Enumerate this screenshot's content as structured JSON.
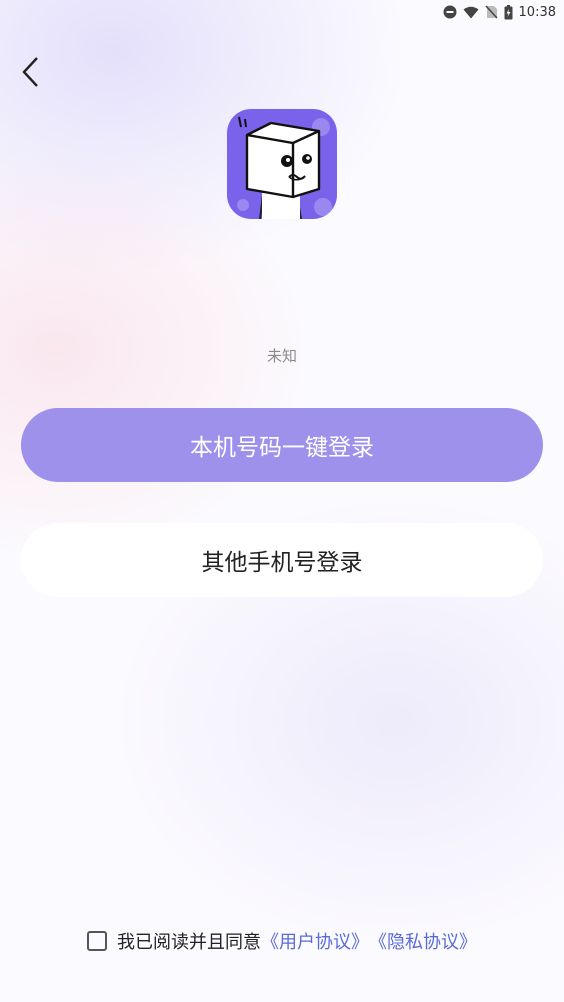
{
  "status_bar": {
    "time": "10:38",
    "icons": [
      "do-not-disturb-icon",
      "wifi-icon",
      "no-sim-icon",
      "battery-icon"
    ]
  },
  "header": {
    "back_icon": "chevron-left-icon"
  },
  "app": {
    "logo_icon": "cube-character-logo"
  },
  "login": {
    "phone_number": "未知",
    "one_click_label": "本机号码一键登录",
    "other_phone_label": "其他手机号登录"
  },
  "agreement": {
    "checked": false,
    "text": "我已阅读并且同意",
    "user_agreement": "《用户协议》",
    "privacy_policy": "《隐私协议》"
  },
  "colors": {
    "primary_button": "#9d91ec",
    "link": "#5b6bd6",
    "logo_bg": "#7a63ea"
  }
}
